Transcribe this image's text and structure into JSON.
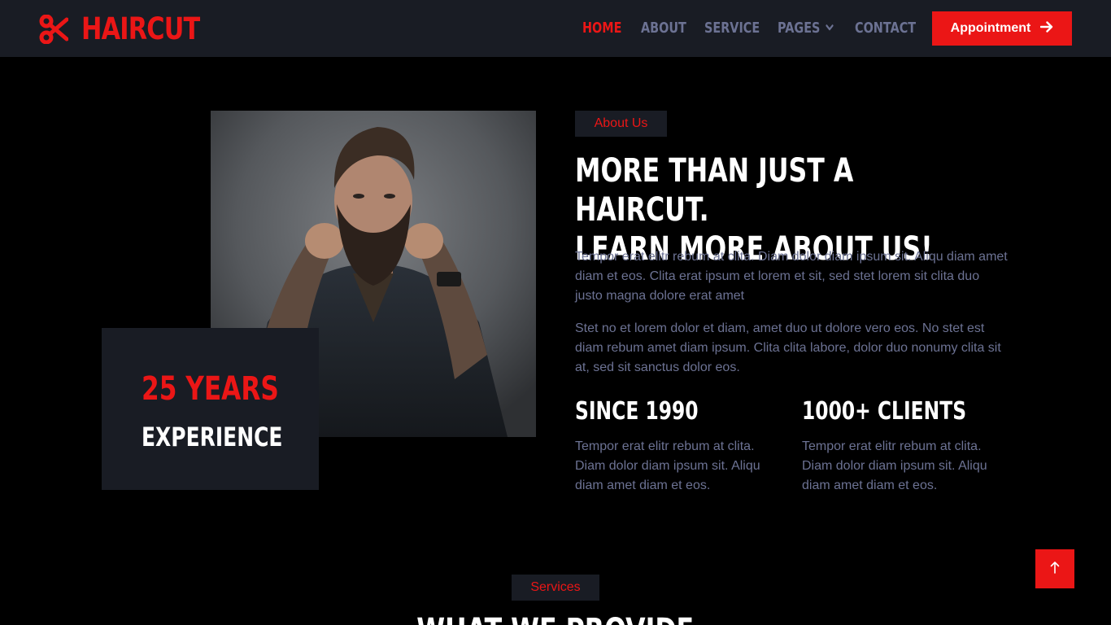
{
  "brand": {
    "name": "HAIRCUT",
    "icon": "scissors-icon"
  },
  "nav": {
    "items": [
      {
        "label": "HOME",
        "active": true
      },
      {
        "label": "ABOUT",
        "active": false
      },
      {
        "label": "SERVICE",
        "active": false
      },
      {
        "label": "PAGES",
        "active": false,
        "dropdown": true
      },
      {
        "label": "CONTACT",
        "active": false
      }
    ],
    "cta_label": "Appointment",
    "cta_icon": "arrow-right-icon"
  },
  "about": {
    "tag": "About Us",
    "title_line1": "More Than Just A Haircut.",
    "title_line2": "Learn More About Us!",
    "para1": "Tempor erat elitr rebum at clita. Diam dolor diam ipsum sit. Aliqu diam amet diam et eos. Clita erat ipsum et lorem et sit, sed stet lorem sit clita duo justo magna dolore erat amet",
    "para2": "Stet no et lorem dolor et diam, amet duo ut dolore vero eos. No stet est diam rebum amet diam ipsum. Clita clita labore, dolor duo nonumy clita sit at, sed sit sanctus dolor eos.",
    "experience": {
      "years": "25 Years",
      "label": "Experience"
    },
    "stats": [
      {
        "title": "Since 1990",
        "text": "Tempor erat elitr rebum at clita. Diam dolor diam ipsum sit. Aliqu diam amet diam et eos."
      },
      {
        "title": "1000+ Clients",
        "text": "Tempor erat elitr rebum at clita. Diam dolor diam ipsum sit. Aliqu diam amet diam et eos."
      }
    ]
  },
  "services": {
    "tag": "Services",
    "title": "What We Provide"
  },
  "colors": {
    "accent": "#eb1616",
    "navbar_bg": "#191c24",
    "text_muted": "#6c7293",
    "page_bg": "#000000"
  },
  "back_to_top_icon": "arrow-up-icon"
}
